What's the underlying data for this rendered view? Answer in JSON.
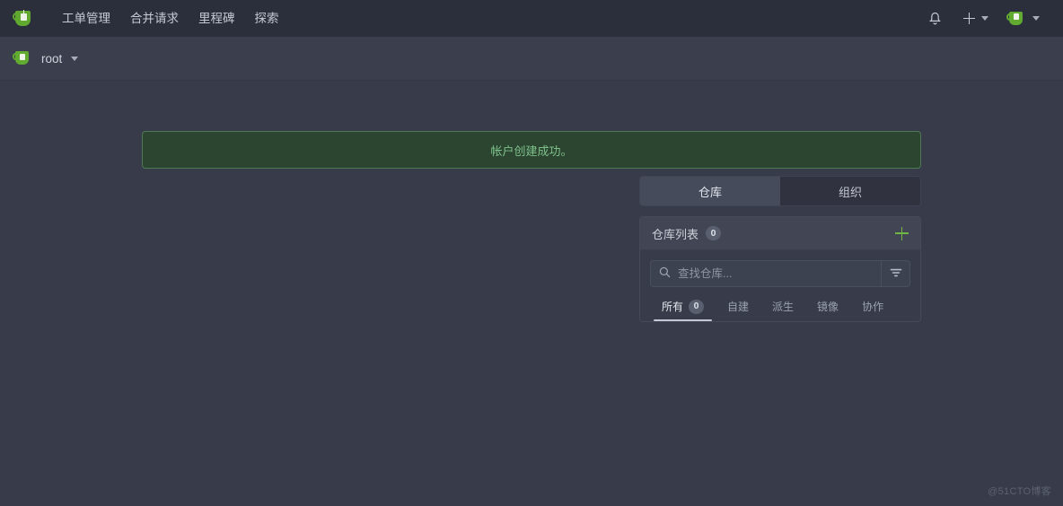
{
  "navbar": {
    "logo_icon": "gitea-teacup-logo",
    "items": [
      {
        "label": "工单管理",
        "name": "nav-item-issues"
      },
      {
        "label": "合并请求",
        "name": "nav-item-pull-requests"
      },
      {
        "label": "里程碑",
        "name": "nav-item-milestones"
      },
      {
        "label": "探索",
        "name": "nav-item-explore"
      }
    ],
    "notification_icon": "bell-icon",
    "create_icon": "plus-icon",
    "create_caret_icon": "chevron-down-icon",
    "avatar_icon": "user-avatar-teacup",
    "avatar_caret_icon": "chevron-down-icon"
  },
  "subnav": {
    "avatar_icon": "user-avatar-teacup",
    "username": "root",
    "caret_icon": "chevron-down-icon"
  },
  "flash": {
    "message": "帐户创建成功。",
    "type": "success",
    "bg_color": "#2b4531",
    "border_color": "#4d7a53",
    "text_color": "#7ec08a"
  },
  "scope_tabs": [
    {
      "label": "仓库",
      "name": "tab-repositories",
      "active": true
    },
    {
      "label": "组织",
      "name": "tab-organizations",
      "active": false
    }
  ],
  "repo_panel": {
    "title": "仓库列表",
    "count": "0",
    "add_icon": "plus-icon",
    "add_color": "#71b544",
    "search": {
      "placeholder": "查找仓库...",
      "value": "",
      "search_icon": "search-icon",
      "filter_icon": "filter-icon"
    },
    "filter_tabs": [
      {
        "label": "所有",
        "count": "0",
        "name": "filter-tab-all",
        "active": true
      },
      {
        "label": "自建",
        "count": "",
        "name": "filter-tab-own",
        "active": false
      },
      {
        "label": "派生",
        "count": "",
        "name": "filter-tab-forks",
        "active": false
      },
      {
        "label": "镜像",
        "count": "",
        "name": "filter-tab-mirrors",
        "active": false
      },
      {
        "label": "协作",
        "count": "",
        "name": "filter-tab-collaborative",
        "active": false
      }
    ]
  },
  "watermark": "@51CTO博客"
}
